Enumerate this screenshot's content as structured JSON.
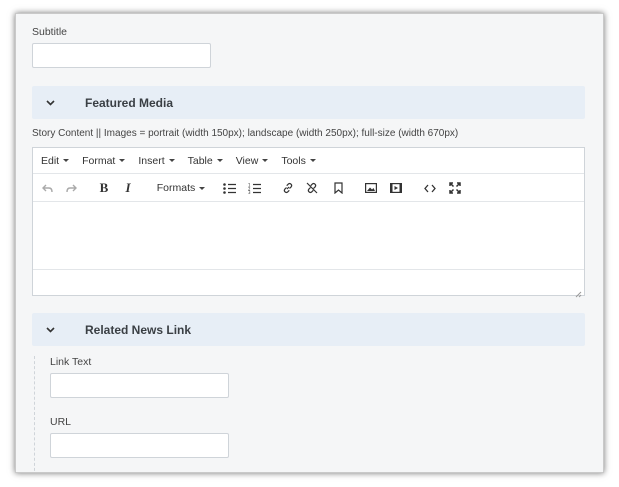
{
  "subtitle": {
    "label": "Subtitle",
    "value": ""
  },
  "featured_media": {
    "title": "Featured Media",
    "icon": "chevron-down-icon"
  },
  "story_content": {
    "label": "Story Content || Images = portrait (width 150px); landscape (width 250px); full-size (width 670px)",
    "menubar": [
      "Edit",
      "Format",
      "Insert",
      "Table",
      "View",
      "Tools"
    ],
    "formats_label": "Formats",
    "bold_label": "B",
    "italic_label": "I",
    "body": ""
  },
  "related_news_link": {
    "title": "Related News Link",
    "icon": "chevron-down-icon",
    "link_text": {
      "label": "Link Text",
      "value": ""
    },
    "url": {
      "label": "URL",
      "value": ""
    }
  },
  "colors": {
    "section_header_bg": "#e7eef6",
    "panel_bg": "#f5f6f7",
    "border": "#cfd4d9"
  }
}
